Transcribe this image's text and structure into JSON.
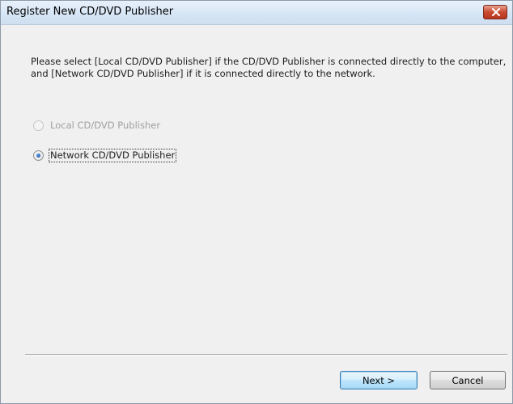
{
  "window": {
    "title": "Register New CD/DVD Publisher",
    "close_icon": "close-icon"
  },
  "instruction": "Please select [Local CD/DVD Publisher] if the CD/DVD Publisher is connected directly to the computer, and [Network CD/DVD Publisher] if it is connected directly to the network.",
  "options": [
    {
      "label": "Local CD/DVD Publisher",
      "selected": false,
      "enabled": false
    },
    {
      "label": "Network CD/DVD Publisher",
      "selected": true,
      "enabled": true
    }
  ],
  "buttons": {
    "next_label": "Next >",
    "cancel_label": "Cancel"
  },
  "colors": {
    "dialog_background": "#f0f0f0",
    "close_button": "#c9492f",
    "default_button_border": "#3c7fb1"
  }
}
